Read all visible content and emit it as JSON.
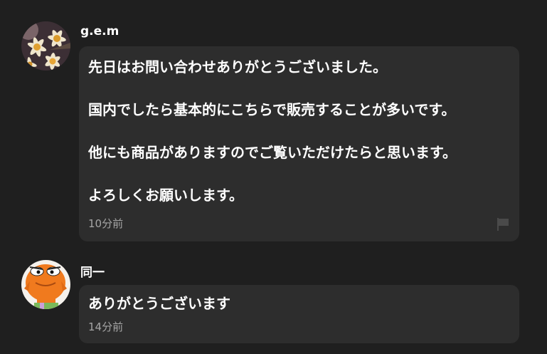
{
  "comments": [
    {
      "username": "g.e.m",
      "avatar_icon": "daisy-flowers-avatar",
      "lines": [
        "先日はお問い合わせありがとうございました。",
        "国内でしたら基本的にこちらで販売することが多いです。",
        "他にも商品がありますのでご覧いただけたらと思います。",
        "よろしくお願いします。"
      ],
      "time": "10分前",
      "report_icon": "flag-icon"
    },
    {
      "username": "同一",
      "avatar_icon": "orange-cartoon-fish-avatar",
      "lines": [
        "ありがとうございます"
      ],
      "time": "14分前"
    }
  ],
  "colors": {
    "background": "#1f1f1f",
    "bubble": "#2d2d2d",
    "text": "#ffffff",
    "timestamp": "#a5a5a5",
    "flag": "#4a4a4a"
  }
}
